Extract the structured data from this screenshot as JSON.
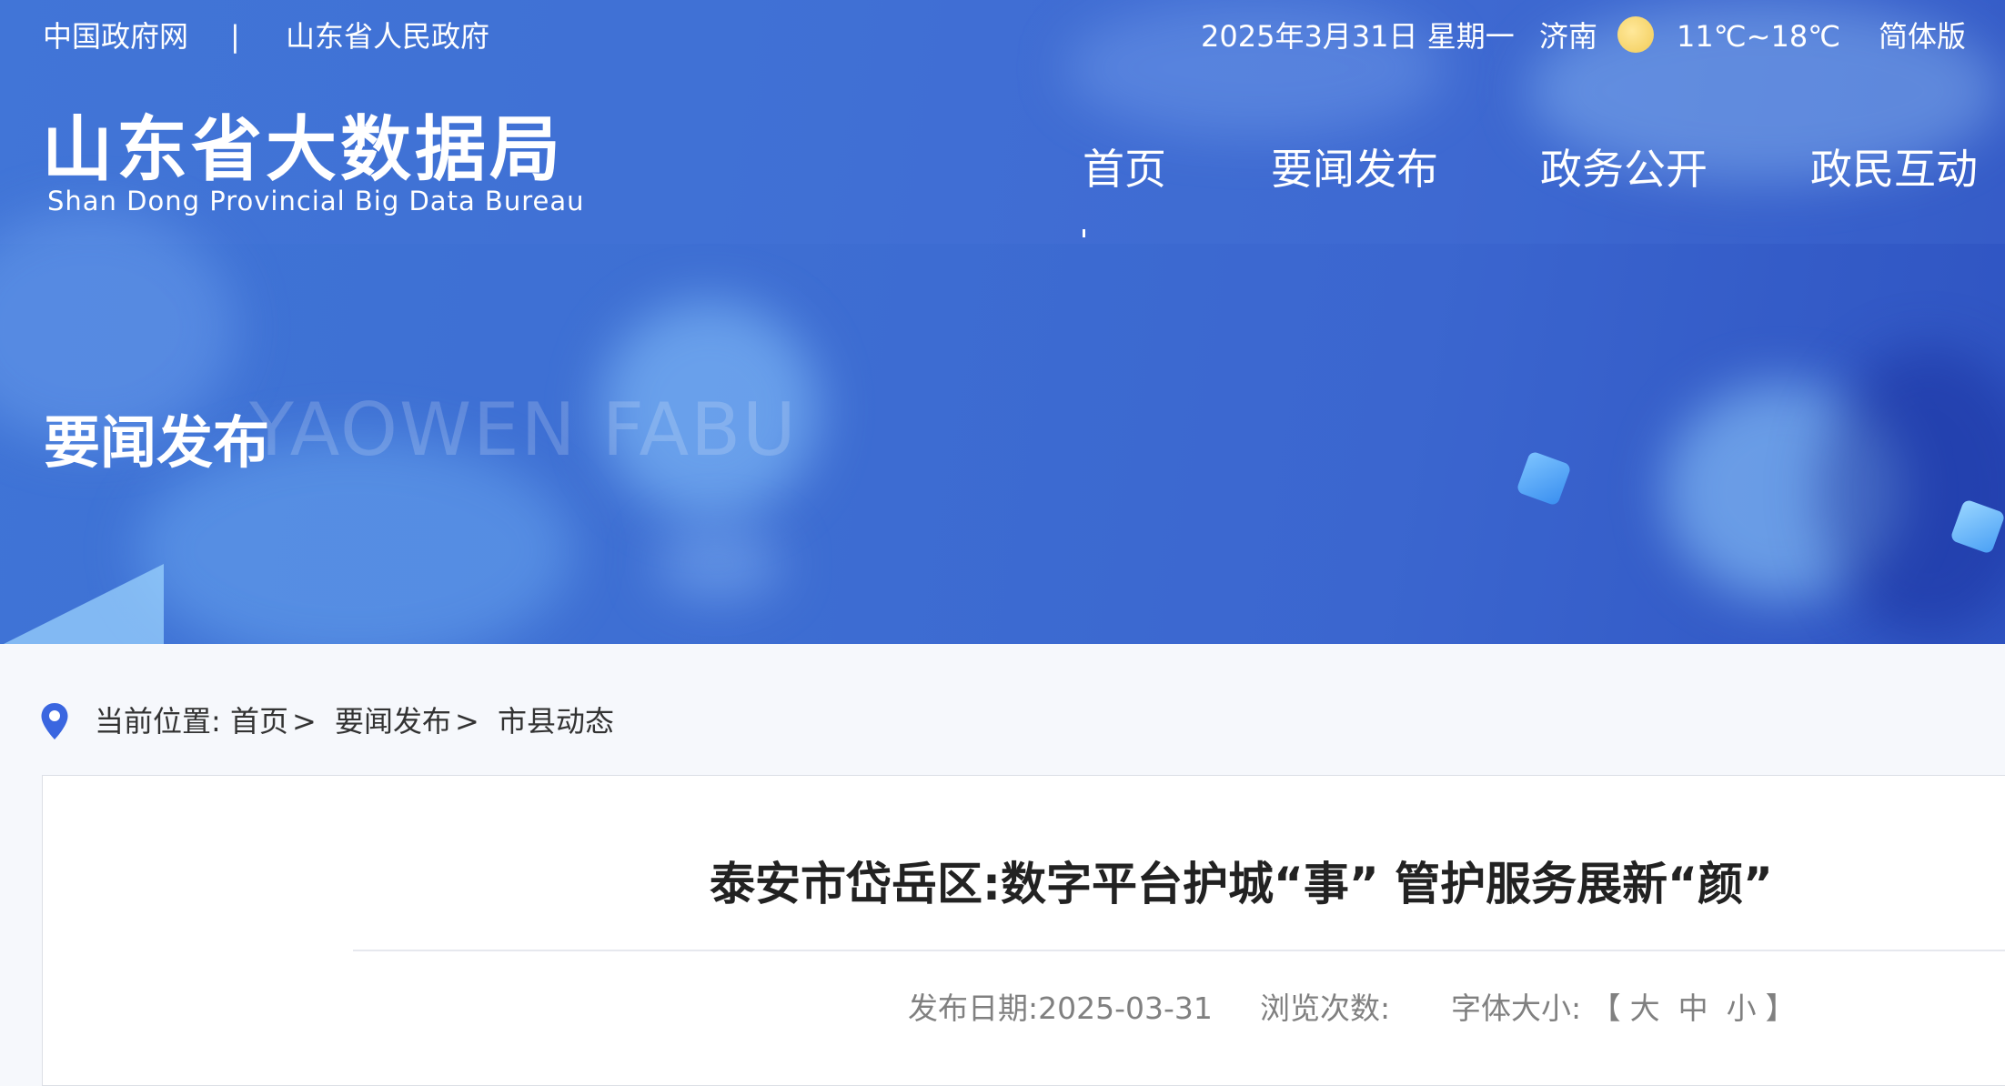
{
  "topbar": {
    "link_gov": "中国政府网",
    "divider": "|",
    "link_province": "山东省人民政府",
    "date": "2025年3月31日 星期一",
    "city": "济南",
    "weather_icon": "sun-icon",
    "temperature": "11℃~18℃",
    "language": "简体版"
  },
  "logo": {
    "name_cn": "山东省大数据局",
    "name_en": "Shan Dong Provincial Big Data Bureau"
  },
  "nav": {
    "items": [
      {
        "label": "首页"
      },
      {
        "label": "要闻发布"
      },
      {
        "label": "政务公开"
      },
      {
        "label": "政民互动"
      }
    ]
  },
  "banner": {
    "section_cn": "要闻发布",
    "section_en": "YAOWEN FABU"
  },
  "breadcrumb": {
    "prefix": "当前位置:",
    "items": [
      "首页",
      "要闻发布",
      "市县动态"
    ],
    "separator": ">"
  },
  "article": {
    "title": "泰安市岱岳区:数字平台护城“事” 管护服务展新“颜”",
    "publish_label": "发布日期:",
    "publish_date": "2025-03-31",
    "views_label": "浏览次数:",
    "views_value": "",
    "fontsize_label": "字体大小:",
    "bracket_open": "【",
    "bracket_close": "】",
    "fontsize_options": [
      "大",
      "中",
      "小"
    ]
  },
  "colors": {
    "banner_blue": "#3e6fd3",
    "pin_blue": "#3a66e0",
    "sun_yellow": "#f2cc58"
  }
}
